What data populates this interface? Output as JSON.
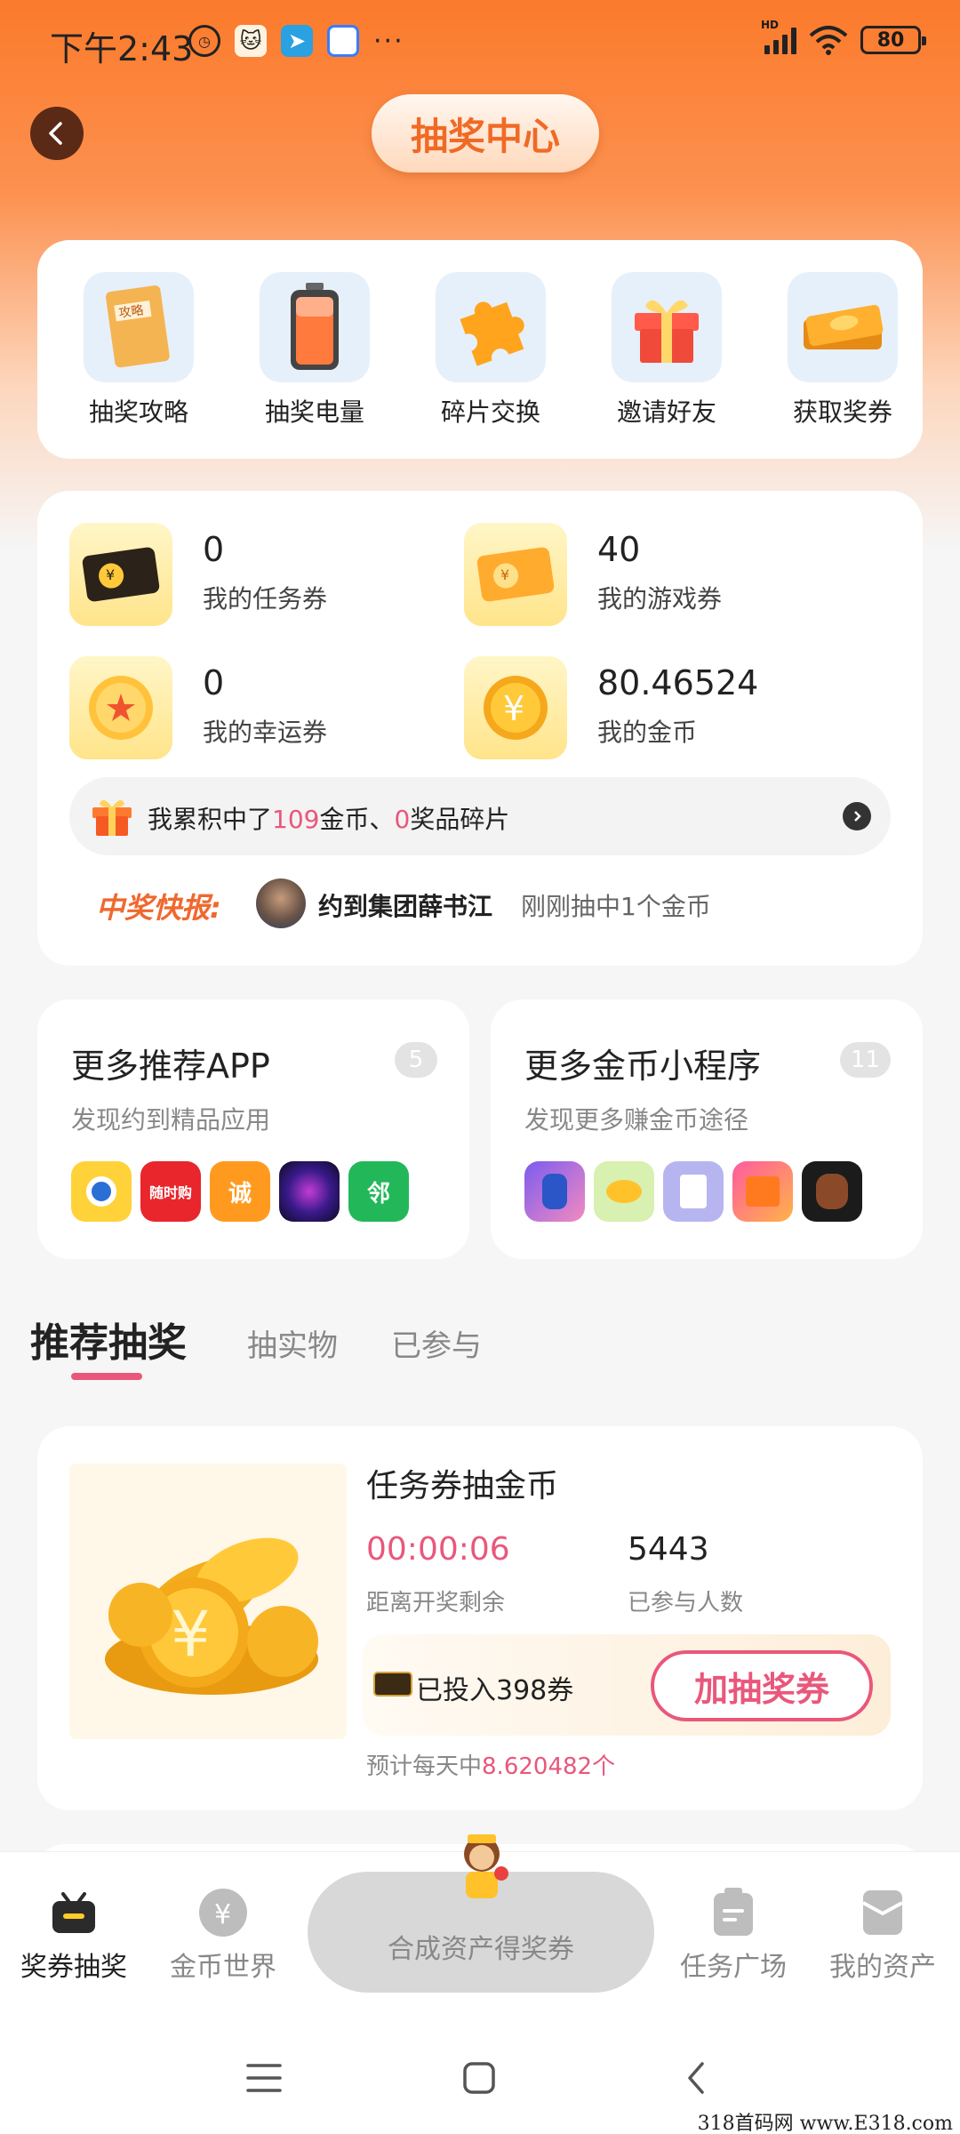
{
  "status_bar": {
    "time": "下午2:43",
    "more": "···",
    "network": "HD",
    "battery": "80"
  },
  "header": {
    "title": "抽奖中心"
  },
  "quick_menu": [
    {
      "label": "抽奖攻略",
      "icon": "strategy-book-icon"
    },
    {
      "label": "抽奖电量",
      "icon": "battery-icon"
    },
    {
      "label": "碎片交换",
      "icon": "puzzle-piece-icon"
    },
    {
      "label": "邀请好友",
      "icon": "gift-box-icon"
    },
    {
      "label": "获取奖券",
      "icon": "ticket-icon"
    }
  ],
  "stats": [
    {
      "value": "0",
      "label": "我的任务券",
      "icon": "task-ticket-icon"
    },
    {
      "value": "40",
      "label": "我的游戏券",
      "icon": "game-ticket-icon"
    },
    {
      "value": "0",
      "label": "我的幸运券",
      "icon": "lucky-coin-icon"
    },
    {
      "value": "80.46524",
      "label": "我的金币",
      "icon": "gold-coin-icon"
    }
  ],
  "accumulated": {
    "prefix": "我累积中了",
    "coins": "109",
    "middle": "金币、",
    "fragments": "0",
    "suffix": "奖品碎片"
  },
  "news": {
    "label": "中奖快报:",
    "user": "约到集团薛书江",
    "message": "刚刚抽中1个金币"
  },
  "recommend": [
    {
      "title": "更多推荐APP",
      "badge": "5",
      "subtitle": "发现约到精品应用",
      "apps": [
        "app-penguin",
        "app-suishigou",
        "app-cheng",
        "app-orb",
        "app-lin"
      ],
      "app_texts": [
        "",
        "随时购",
        "诚",
        "",
        "邻"
      ]
    },
    {
      "title": "更多金币小程序",
      "badge": "11",
      "subtitle": "发现更多赚金币途径",
      "apps": [
        "app-hero",
        "app-coins",
        "app-doc",
        "app-box",
        "app-jar"
      ],
      "app_texts": [
        "",
        "",
        "",
        "",
        ""
      ]
    }
  ],
  "tabs": [
    {
      "label": "推荐抽奖",
      "active": true
    },
    {
      "label": "抽实物",
      "active": false
    },
    {
      "label": "已参与",
      "active": false
    }
  ],
  "lottery": {
    "title": "任务券抽金币",
    "countdown": "00:00:06",
    "countdown_label": "距离开奖剩余",
    "joined": "5443",
    "joined_label": "已参与人数",
    "invested": "已投入398券",
    "add_button": "加抽奖券",
    "estimate_prefix": "预计每天中",
    "estimate_value": "8.620482个"
  },
  "bottom_nav": [
    {
      "label": "奖券抽奖",
      "icon": "ticket-box-icon",
      "active": true
    },
    {
      "label": "金币世界",
      "icon": "yuan-coin-icon",
      "active": false
    },
    {
      "label": "任务广场",
      "icon": "clipboard-icon",
      "active": false
    },
    {
      "label": "我的资产",
      "icon": "wallet-icon",
      "active": false
    }
  ],
  "center_action": {
    "label": "合成资产得奖券"
  },
  "watermark": "318首码网 www.E318.com",
  "colors": {
    "brand_orange": "#fb7a2b",
    "accent_pink": "#e9577b",
    "title_orange": "#f06a25"
  }
}
